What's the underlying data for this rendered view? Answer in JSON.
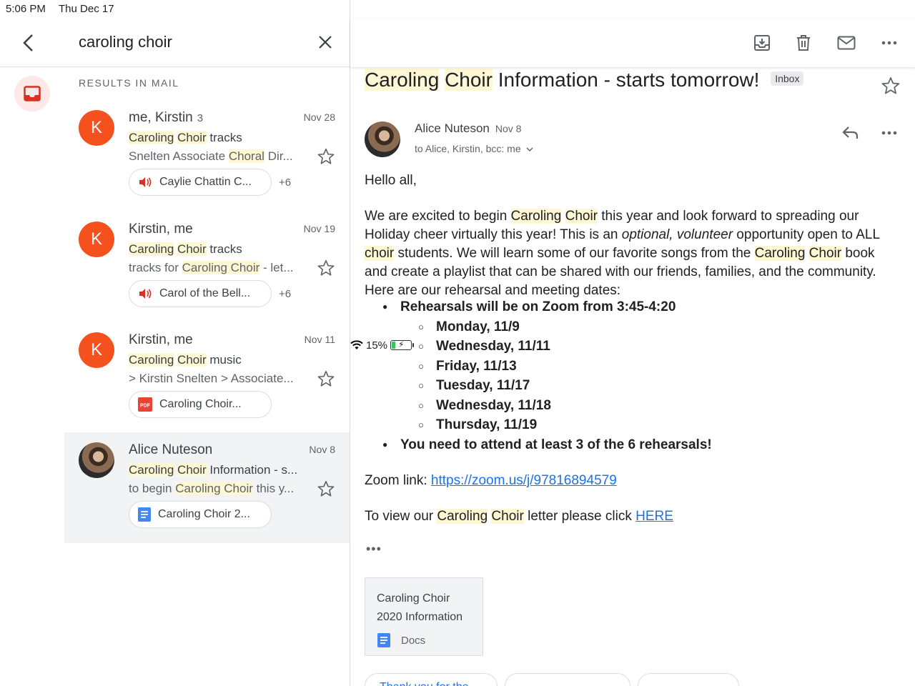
{
  "status_bar": {
    "time": "5:06 PM",
    "date": "Thu Dec 17",
    "battery": "15%"
  },
  "search": {
    "query": "caroling choir"
  },
  "results_heading": "RESULTS IN MAIL",
  "threads": [
    {
      "avatar": "K",
      "sender": "me, Kirstin",
      "count": "3",
      "date": "Nov 28",
      "subject_parts": [
        "Caroling",
        " ",
        "Choir",
        " tracks"
      ],
      "snippet_parts": [
        "Snelten Associate ",
        "Choral",
        " Dir..."
      ],
      "chip_label": "Caylie Chattin C...",
      "chip_icon": "audio-icon",
      "more": "+6"
    },
    {
      "avatar": "K",
      "sender": "Kirstin, me",
      "count": "",
      "date": "Nov 19",
      "subject_parts": [
        "Caroling",
        " ",
        "Choir",
        " tracks"
      ],
      "snippet_parts": [
        "tracks for ",
        "Caroling Choir",
        " - let..."
      ],
      "chip_label": "Carol of the Bell...",
      "chip_icon": "audio-icon",
      "more": "+6"
    },
    {
      "avatar": "K",
      "sender": "Kirstin, me",
      "count": "",
      "date": "Nov 11",
      "subject_parts": [
        "Caroling",
        " ",
        "Choir",
        " music"
      ],
      "snippet_parts": [
        "> Kirstin Snelten > Associate",
        "..."
      ],
      "chip_label": "Caroling Choir...",
      "chip_icon": "pdf-icon",
      "more": ""
    },
    {
      "avatar": "",
      "sender": "Alice Nuteson",
      "count": "",
      "date": "Nov 8",
      "subject_parts": [
        "Caroling",
        " ",
        "Choir",
        " Information - s..."
      ],
      "snippet_parts": [
        "to begin ",
        "Caroling Choir",
        " this y..."
      ],
      "chip_label": "Caroling Choir 2...",
      "chip_icon": "docs-icon",
      "more": ""
    }
  ],
  "message": {
    "title_hl1": "Caroling",
    "title_hl2": "Choir",
    "title_rest": " Information - starts tomorrow!",
    "label": "Inbox",
    "from": "Alice Nuteson",
    "date": "Nov 8",
    "to": "to Alice, Kirstin, bcc: me",
    "greeting": "Hello all,",
    "para1": {
      "a": "We are excited to begin ",
      "hl1": "Caroling",
      "hl2": "Choir",
      "b": " this year and look forward to spreading our Holiday cheer virtually this year!  This is an ",
      "italic": "optional, volunteer",
      "c": " opportunity open to ALL ",
      "hl3": "choir",
      "d": " students.  We will learn some of our favorite songs from the ",
      "hl4": "Caroling",
      "hl5": "Choir",
      "e": " book and create a playlist that can be shared with our friends, families, and the community.  Here are our rehearsal and meeting dates:"
    },
    "bullet1": "Rehearsals will be on Zoom from 3:45-4:20",
    "dates": [
      "Monday, 11/9",
      "Wednesday, 11/11",
      "Friday, 11/13",
      "Tuesday, 11/17",
      "Wednesday, 11/18",
      "Thursday, 11/19"
    ],
    "bullet2": "You need to attend at least 3 of the 6 rehearsals!",
    "zoom_label": "Zoom link:  ",
    "zoom_url": "https://zoom.us/j/97816894579",
    "letter": {
      "a": "To view our ",
      "hl1": "Caroling",
      "hl2": "Choir",
      "b": " letter please click ",
      "link": "HERE"
    },
    "trimmed": "•••",
    "attachment": {
      "title": "Caroling Choir 2020 Information",
      "type": "Docs"
    },
    "smart_replies": [
      "Thank you for the...",
      "",
      ""
    ]
  },
  "colors": {
    "avatar": "#f4511e",
    "highlight": "#fef7d4",
    "link": "#1a73e8"
  }
}
